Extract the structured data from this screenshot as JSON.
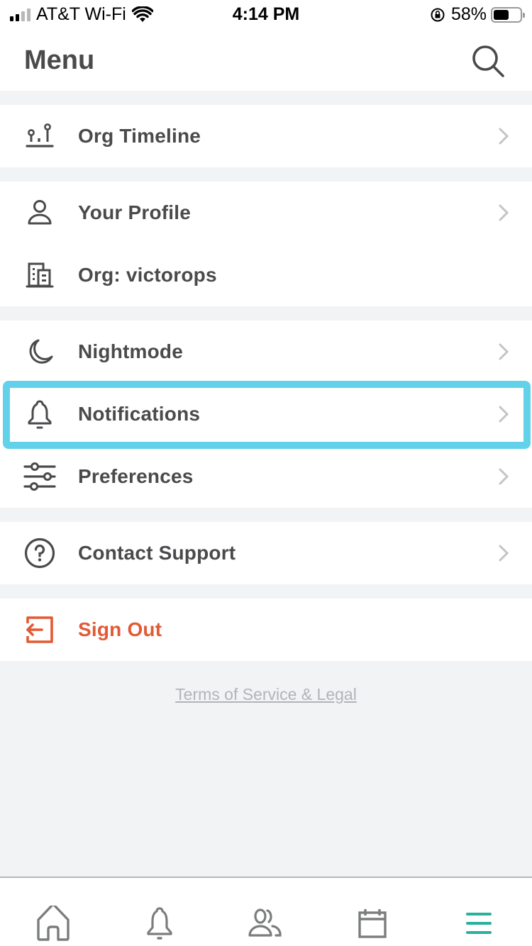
{
  "status_bar": {
    "carrier": "AT&T Wi-Fi",
    "time": "4:14 PM",
    "battery": "58%",
    "battery_level": 0.58,
    "icons": [
      "signal-icon",
      "wifi-icon",
      "orientation-lock-icon",
      "battery-icon"
    ]
  },
  "header": {
    "title": "Menu",
    "search_icon": "search-icon"
  },
  "menu": {
    "groups": [
      {
        "items": [
          {
            "label": "Org Timeline",
            "icon": "timeline-icon",
            "chevron": true
          }
        ]
      },
      {
        "items": [
          {
            "label": "Your Profile",
            "icon": "person-icon",
            "chevron": true
          },
          {
            "label": "Org: victorops",
            "icon": "building-icon",
            "chevron": false
          }
        ]
      },
      {
        "items": [
          {
            "label": "Nightmode",
            "icon": "moon-icon",
            "chevron": true
          },
          {
            "label": "Notifications",
            "icon": "bell-icon",
            "chevron": true,
            "highlighted": true
          },
          {
            "label": "Preferences",
            "icon": "sliders-icon",
            "chevron": true
          }
        ]
      },
      {
        "items": [
          {
            "label": "Contact Support",
            "icon": "help-circle-icon",
            "chevron": true
          }
        ]
      },
      {
        "items": [
          {
            "label": "Sign Out",
            "icon": "sign-out-icon",
            "chevron": false
          }
        ]
      }
    ]
  },
  "footer": {
    "terms_link": "Terms of Service & Legal"
  },
  "tabbar": {
    "tabs": [
      {
        "name": "home",
        "icon": "home-icon",
        "active": false
      },
      {
        "name": "alerts",
        "icon": "bell-icon",
        "active": false
      },
      {
        "name": "people",
        "icon": "people-icon",
        "active": false
      },
      {
        "name": "schedule",
        "icon": "calendar-icon",
        "active": false
      },
      {
        "name": "menu",
        "icon": "hamburger-icon",
        "active": true
      }
    ]
  },
  "colors": {
    "text": "#4a4a4c",
    "danger": "#e25a34",
    "highlight": "#62d2ea",
    "active_tab": "#2ab0a0",
    "inactive_tab": "#7b7d7d",
    "chevron": "#c4c4c6",
    "background": "#f2f3f5"
  }
}
